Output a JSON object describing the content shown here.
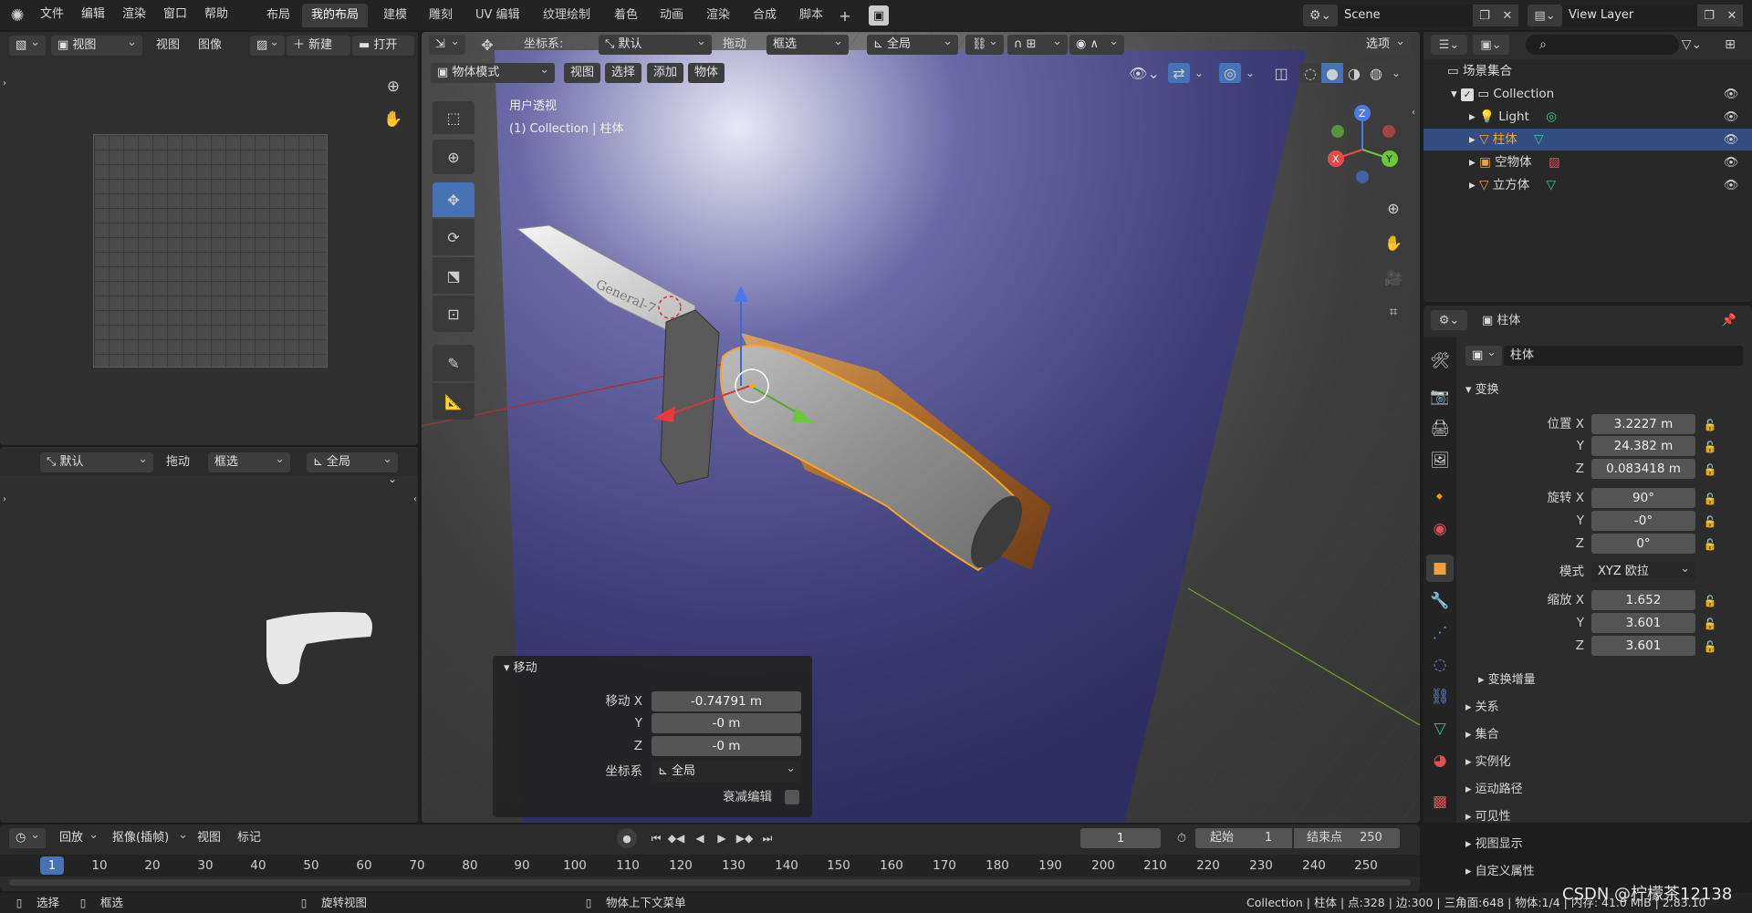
{
  "menu": {
    "items": [
      "文件",
      "编辑",
      "渲染",
      "窗口",
      "帮助"
    ]
  },
  "workspaces": [
    "布局",
    "我的布局",
    "建模",
    "雕刻",
    "UV 编辑",
    "纹理绘制",
    "着色",
    "动画",
    "渲染",
    "合成",
    "脚本"
  ],
  "workspace_active": 1,
  "scene": {
    "name": "Scene",
    "view_layer": "View Layer"
  },
  "image_editor": {
    "mode": "视图",
    "menus": [
      "视图",
      "图像"
    ],
    "new": "新建",
    "open": "打开"
  },
  "lower_left": {
    "pivot": "默认",
    "drag": "拖动",
    "select": "框选",
    "orient": "全局"
  },
  "viewport": {
    "header": {
      "coord_label": "坐标系:",
      "coord_value": "默认",
      "drag": "拖动",
      "select": "框选",
      "orient": "全局",
      "options": "选项"
    },
    "mode": "物体模式",
    "menus": [
      "视图",
      "选择",
      "添加",
      "物体"
    ],
    "info_line1": "用户透视",
    "info_line2": "(1) Collection | 柱体",
    "knife_text": "General-7",
    "gizmo": {
      "x": "X",
      "y": "Y",
      "z": "Z"
    }
  },
  "operator_panel": {
    "title": "移动",
    "move_x_label": "移动 X",
    "move_x": "-0.74791 m",
    "y_label": "Y",
    "y": "-0 m",
    "z_label": "Z",
    "z": "-0 m",
    "coord_label": "坐标系",
    "coord_value": "全局",
    "prop_label": "衰减编辑"
  },
  "outliner": {
    "root": "场景集合",
    "collection": "Collection",
    "items": [
      {
        "name": "Light",
        "selected": false
      },
      {
        "name": "柱体",
        "selected": true
      },
      {
        "name": "空物体",
        "selected": false
      },
      {
        "name": "立方体",
        "selected": false
      }
    ]
  },
  "properties": {
    "header_object": "柱体",
    "object_name": "柱体",
    "section_transform": "变换",
    "loc_label": "位置 X",
    "loc_x": "3.2227 m",
    "loc_y": "24.382 m",
    "loc_z": "0.083418 m",
    "rot_label": "旋转 X",
    "rot_x": "90°",
    "rot_y": "-0°",
    "rot_z": "0°",
    "mode_label": "模式",
    "mode_value": "XYZ 欧拉",
    "scale_label": "缩放 X",
    "scale_x": "1.652",
    "scale_y": "3.601",
    "scale_z": "3.601",
    "y_label": "Y",
    "z_label": "Z",
    "delta": "变换增量",
    "sections": [
      "关系",
      "集合",
      "实例化",
      "运动路径",
      "可见性",
      "视图显示",
      "自定义属性"
    ]
  },
  "timeline": {
    "playback": "回放",
    "keying": "抠像(插帧)",
    "view": "视图",
    "marker": "标记",
    "current_frame": "1",
    "start_label": "起始",
    "start": "1",
    "end_label": "结束点",
    "end": "250",
    "ticks": [
      "1",
      "10",
      "20",
      "30",
      "40",
      "50",
      "60",
      "70",
      "80",
      "90",
      "100",
      "110",
      "120",
      "130",
      "140",
      "150",
      "160",
      "170",
      "180",
      "190",
      "200",
      "210",
      "220",
      "230",
      "240",
      "250"
    ]
  },
  "statusbar": {
    "select": "选择",
    "box": "框选",
    "rotate": "旋转视图",
    "context": "物体上下文菜单",
    "stats": "Collection | 柱体 | 点:328 | 边:300 | 三角面:648 | 物体:1/4 | 内存: 41.0 MiB | 2.83.10",
    "watermark": "CSDN @柠檬茶12138"
  },
  "colors": {
    "accent": "#4772b3",
    "selected_row": "#334d80",
    "orange": "#f5a623"
  }
}
